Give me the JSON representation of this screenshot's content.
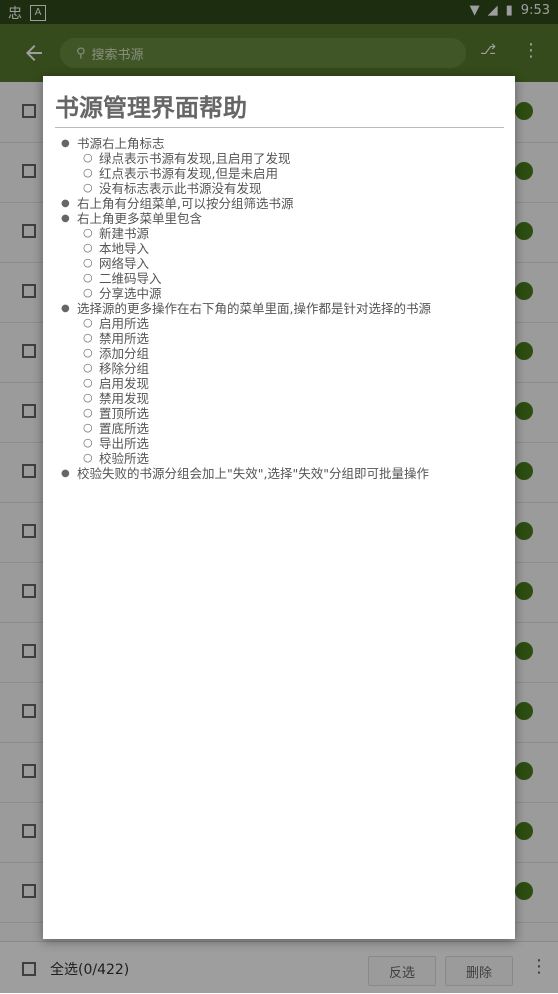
{
  "statusbar": {
    "time": "9:53",
    "app_badge": "A",
    "left_glyph": "忠"
  },
  "toolbar": {
    "search_placeholder": "搜索书源",
    "action_icon": "group-filter-icon"
  },
  "list": {
    "rows": 14
  },
  "bottombar": {
    "select_all": "全选(0/422)",
    "invert": "反选",
    "delete": "删除"
  },
  "dialog": {
    "title": "书源管理界面帮助",
    "sections": [
      {
        "text": "书源右上角标志",
        "children": [
          "绿点表示书源有发现,且启用了发现",
          "红点表示书源有发现,但是未启用",
          "没有标志表示此书源没有发现"
        ]
      },
      {
        "text": "右上角有分组菜单,可以按分组筛选书源",
        "children": []
      },
      {
        "text": "右上角更多菜单里包含",
        "children": [
          "新建书源",
          "本地导入",
          "网络导入",
          "二维码导入",
          "分享选中源"
        ]
      },
      {
        "text": "选择源的更多操作在右下角的菜单里面,操作都是针对选择的书源",
        "children": [
          "启用所选",
          "禁用所选",
          "添加分组",
          "移除分组",
          "启用发现",
          "禁用发现",
          "置顶所选",
          "置底所选",
          "导出所选",
          "校验所选"
        ]
      },
      {
        "text": "校验失败的书源分组会加上\"失效\",选择\"失效\"分组即可批量操作",
        "children": []
      }
    ]
  }
}
